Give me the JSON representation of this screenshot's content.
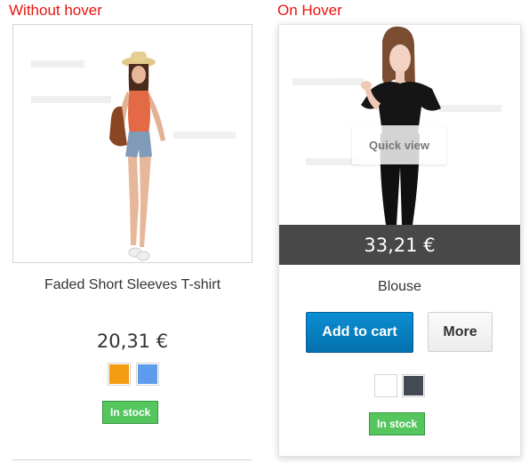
{
  "labels": {
    "without_hover": "Without hover",
    "on_hover": "On Hover"
  },
  "products": {
    "left": {
      "title": "Faded Short Sleeves T-shirt",
      "price": "20,31 €",
      "swatches": [
        {
          "name": "Orange",
          "color": "#f39c11"
        },
        {
          "name": "Blue",
          "color": "#5d9cec"
        }
      ],
      "stock": "In stock"
    },
    "right": {
      "title": "Blouse",
      "price": "33,21 €",
      "quick_view": "Quick view",
      "add_to_cart": "Add to cart",
      "more": "More",
      "swatches": [
        {
          "name": "White",
          "color": "#ffffff"
        },
        {
          "name": "Black",
          "color": "#434a54"
        }
      ],
      "stock": "In stock"
    }
  }
}
